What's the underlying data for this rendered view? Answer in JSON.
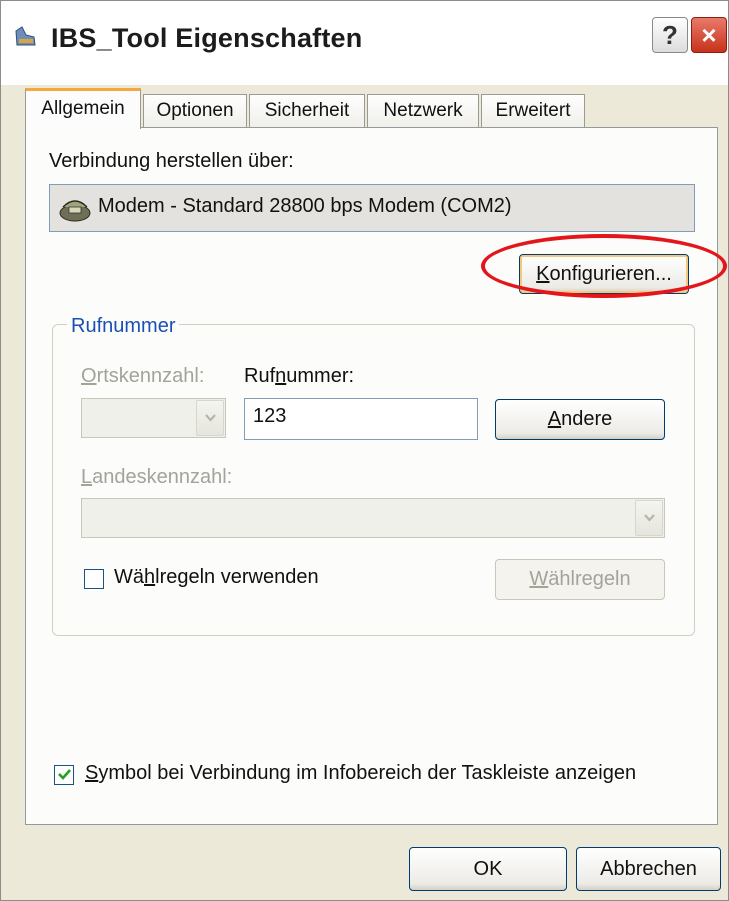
{
  "window": {
    "title": "IBS_Tool Eigenschaften",
    "help_label": "?",
    "close_label": "×"
  },
  "tabs": [
    {
      "label": "Allgemein",
      "active": true
    },
    {
      "label": "Optionen",
      "active": false
    },
    {
      "label": "Sicherheit",
      "active": false
    },
    {
      "label": "Netzwerk",
      "active": false
    },
    {
      "label": "Erweitert",
      "active": false
    }
  ],
  "connection": {
    "label": "Verbindung herstellen über:",
    "device": "Modem - Standard 28800 bps Modem (COM2)",
    "configure_pre": "K",
    "configure_rest": "onfigurieren..."
  },
  "rufnummer": {
    "group_title": "Rufnummer",
    "ortskennzahl_pre": "O",
    "ortskennzahl_rest": "rtskennzahl:",
    "rufnummer_pre": "Ruf",
    "rufnummer_u": "n",
    "rufnummer_rest": "ummer:",
    "rufnummer_value": "123",
    "andere_pre": "A",
    "andere_rest": "ndere",
    "landeskennzahl_pre": "L",
    "landeskennzahl_rest": "andeskennzahl:",
    "waehlregeln_check_pre": "Wä",
    "waehlregeln_check_u": "h",
    "waehlregeln_check_rest": "lregeln verwenden",
    "waehlregeln_check_checked": false,
    "waehlregeln_btn_pre": "W",
    "waehlregeln_btn_rest": "ählregeln"
  },
  "symbol_option": {
    "pre": "S",
    "rest": "ymbol bei Verbindung im Infobereich der Taskleiste anzeigen",
    "checked": true
  },
  "footer": {
    "ok": "OK",
    "cancel": "Abbrechen"
  },
  "colors": {
    "annotation_circle": "#e3161c",
    "group_title": "#1a4fb4",
    "active_tab_accent": "#f2a83c"
  },
  "icons": {
    "title": "dialup-connection-icon",
    "device": "modem-icon",
    "check": "checkmark-icon"
  }
}
